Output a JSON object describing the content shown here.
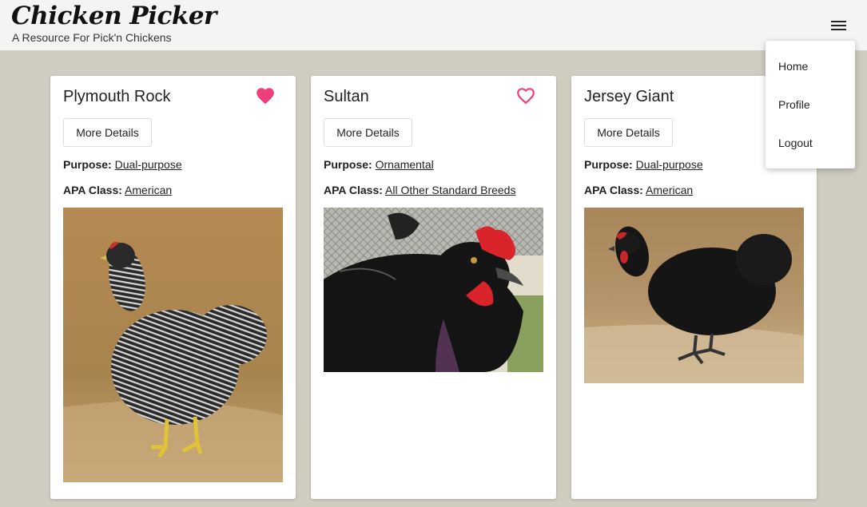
{
  "header": {
    "title": "Chicken Picker",
    "subtitle": "A Resource For Pick'n Chickens"
  },
  "menu": {
    "items": [
      {
        "label": "Home"
      },
      {
        "label": "Profile"
      },
      {
        "label": "Logout"
      }
    ]
  },
  "labels": {
    "more_details": "More Details",
    "purpose": "Purpose:",
    "apa_class": "APA Class:"
  },
  "colors": {
    "favorite": "#ee3d7a",
    "background": "#cfccc0"
  },
  "cards": [
    {
      "name": "Plymouth Rock",
      "favorited": true,
      "purpose": "Dual-purpose",
      "apa_class": "American"
    },
    {
      "name": "Sultan",
      "favorited": false,
      "purpose": "Ornamental",
      "apa_class": "All Other Standard Breeds"
    },
    {
      "name": "Jersey Giant",
      "favorited": false,
      "purpose": "Dual-purpose",
      "apa_class": "American"
    }
  ]
}
